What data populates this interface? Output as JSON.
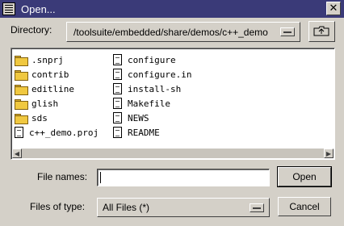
{
  "window": {
    "title": "Open..."
  },
  "directory": {
    "label": "Directory:",
    "path": "/toolsuite/embedded/share/demos/c++_demo"
  },
  "files": {
    "folders": [
      ".snprj",
      "contrib",
      "editline",
      "glish",
      "sds"
    ],
    "first_column_file": "c++_demo.proj",
    "column2": [
      "configure",
      "configure.in",
      "install-sh",
      "Makefile",
      "NEWS",
      "README"
    ]
  },
  "file_name": {
    "label": "File names:",
    "value": ""
  },
  "file_type": {
    "label": "Files of type:",
    "selected": "All Files (*)"
  },
  "buttons": {
    "open": "Open",
    "cancel": "Cancel"
  },
  "colors": {
    "titlebar": "#3a3a78",
    "dialog": "#d4d0c8",
    "folder": "#f0c840"
  }
}
